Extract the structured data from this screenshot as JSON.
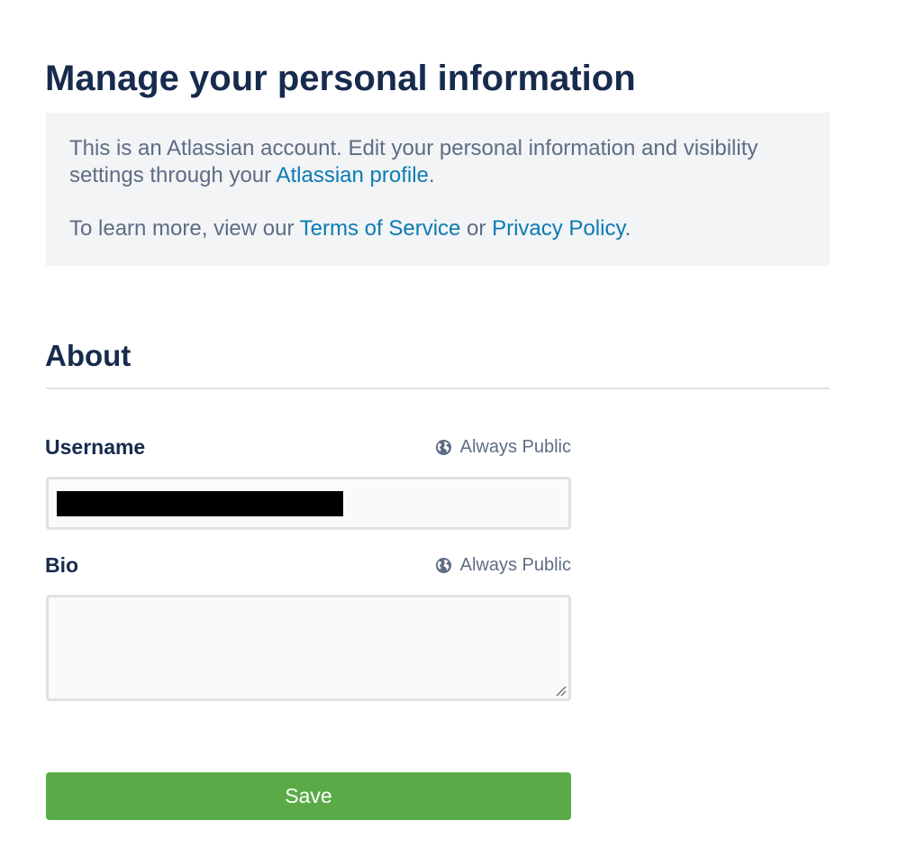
{
  "page": {
    "title": "Manage your personal information"
  },
  "notice": {
    "line1_text": "This is an Atlassian account. Edit your personal information and visibility settings through your ",
    "line1_link": "Atlassian profile",
    "line1_end": ".",
    "line2_text": "To learn more, view our ",
    "terms_link": "Terms of Service",
    "or_text": " or ",
    "privacy_link": "Privacy Policy",
    "line2_end": "."
  },
  "about": {
    "title": "About",
    "username": {
      "label": "Username",
      "visibility": "Always Public",
      "visibility_icon": "globe-icon",
      "value_redacted": true
    },
    "bio": {
      "label": "Bio",
      "visibility": "Always Public",
      "visibility_icon": "globe-icon",
      "value": ""
    }
  },
  "actions": {
    "save_label": "Save"
  },
  "colors": {
    "heading": "#172b4d",
    "muted_text": "#5e6c84",
    "link": "#0c7bb3",
    "notice_bg": "#f2f4f6",
    "save_button": "#5aab47"
  }
}
